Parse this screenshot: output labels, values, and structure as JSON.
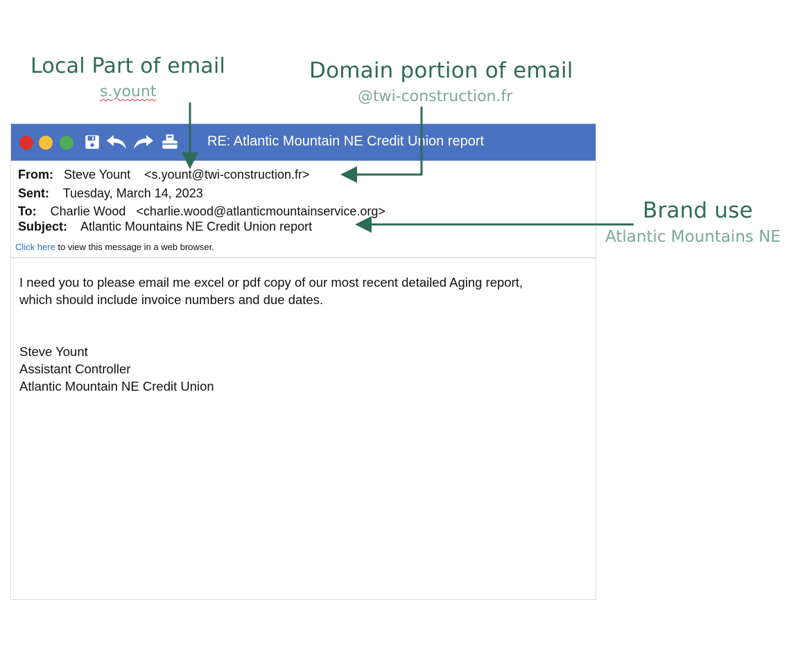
{
  "annotations": {
    "local_part": {
      "title": "Local Part of email",
      "value": "s.yount"
    },
    "domain_portion": {
      "title": "Domain portion of email",
      "value": "@twi-construction.fr"
    },
    "brand_use": {
      "title": "Brand use",
      "value": "Atlantic Mountains NE"
    }
  },
  "window": {
    "title": "RE: Atlantic Mountain NE Credit Union report",
    "controls": [
      "close-dot",
      "minimize-dot",
      "maximize-dot"
    ],
    "toolbar_icons": [
      "save-icon",
      "reply-icon",
      "forward-icon",
      "print-icon"
    ]
  },
  "email": {
    "from_label": "From:",
    "from_name": "Steve Yount",
    "from_address": "<s.yount@twi-construction.fr>",
    "sent_label": "Sent:",
    "sent_value": "Tuesday, March 14, 2023",
    "to_label": "To:",
    "to_name": "Charlie Wood",
    "to_address": "<charlie.wood@atlanticmountainservice.org>",
    "subject_label": "Subject:",
    "subject_value": "Atlantic Mountains NE Credit Union report",
    "web_link": "Click here",
    "web_text": " to view this message in a web browser.",
    "body_line1": "I need you to please email me excel or pdf copy of our most recent detailed Aging report,",
    "body_line2": "which should include invoice numbers and due dates.",
    "signature_name": "Steve Yount",
    "signature_title": "Assistant Controller",
    "signature_org": "Atlantic Mountain NE Credit Union"
  },
  "colors": {
    "titlebar": "#4a72c0",
    "annotation_dark": "#2e6b58",
    "annotation_light": "#7aa898",
    "link": "#2a6fc9"
  }
}
